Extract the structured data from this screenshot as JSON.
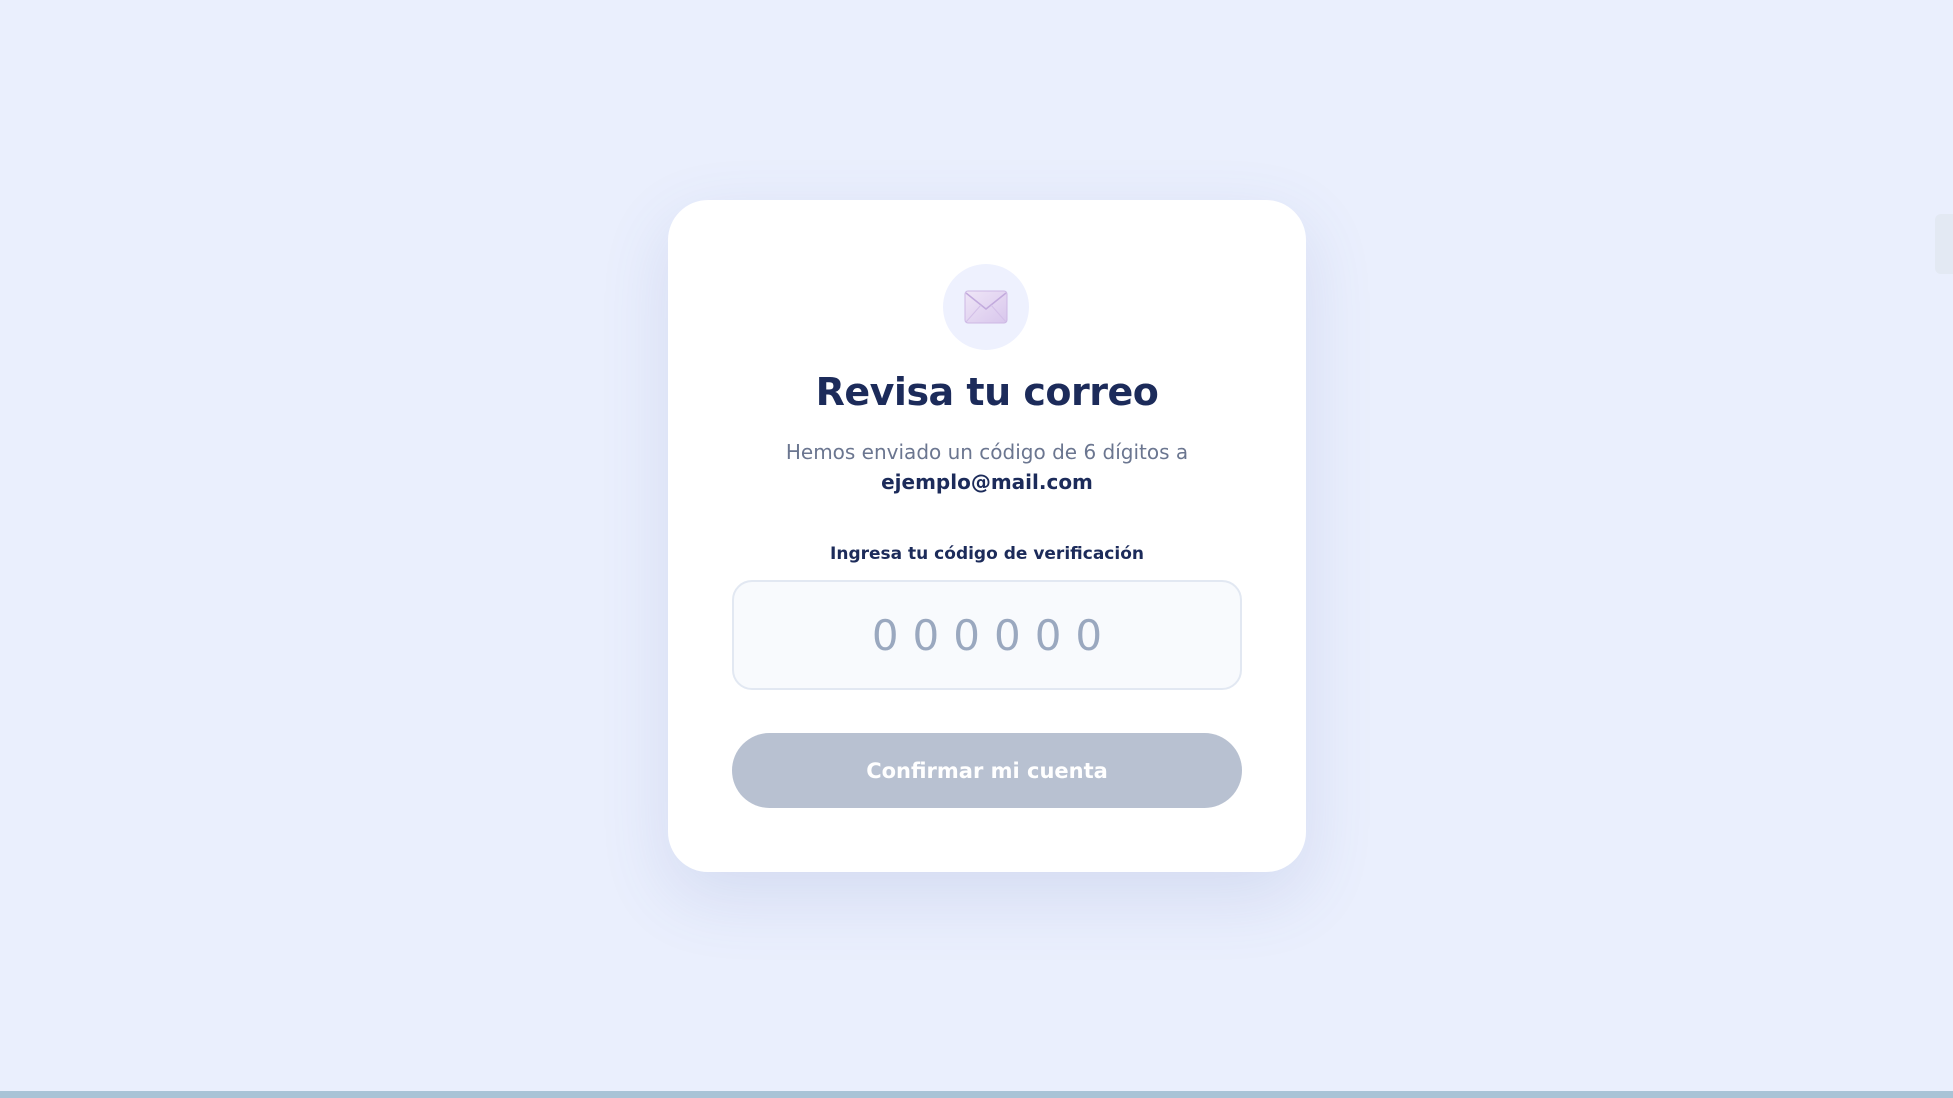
{
  "verify": {
    "title": "Revisa tu correo",
    "subtitle": "Hemos enviado un código de 6 dígitos a",
    "email": "ejemplo@mail.com",
    "code_label": "Ingresa tu código de verificación",
    "code_value": "",
    "code_placeholder": "000000",
    "confirm_label": "Confirmar mi cuenta",
    "icon": "envelope-icon"
  },
  "colors": {
    "background": "#eaeffd",
    "card": "#ffffff",
    "heading": "#1c2b5a",
    "muted_text": "#6b7690",
    "button_disabled": "#b8c1d1",
    "icon_circle": "#eef1fe"
  }
}
